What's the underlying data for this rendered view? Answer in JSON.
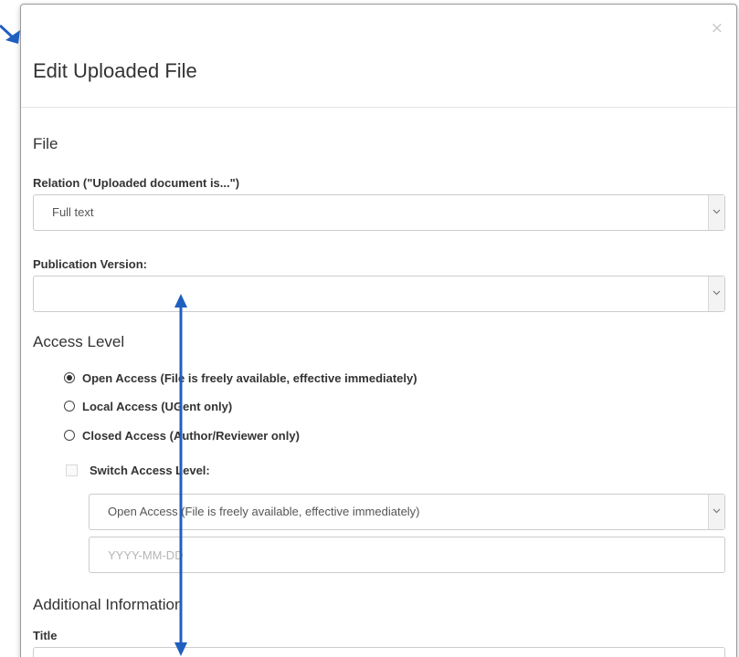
{
  "dialog": {
    "title": "Edit Uploaded File",
    "close_symbol": "×"
  },
  "file_section": {
    "heading": "File",
    "relation": {
      "label": "Relation (\"Uploaded document is...\")",
      "selected": "Full text"
    },
    "publication_version": {
      "label": "Publication Version:",
      "selected": ""
    }
  },
  "access_section": {
    "heading": "Access Level",
    "options": [
      {
        "label": "Open Access (File is freely available, effective immediately)",
        "checked": true
      },
      {
        "label": "Local Access (UGent only)",
        "checked": false
      },
      {
        "label": "Closed Access (Author/Reviewer only)",
        "checked": false
      }
    ],
    "switch": {
      "label": "Switch Access Level:",
      "checked": false,
      "selected": "Open Access (File is freely available, effective immediately)",
      "date_placeholder": "YYYY-MM-DD"
    }
  },
  "additional_section": {
    "heading": "Additional Information",
    "title_label": "Title"
  },
  "colors": {
    "annotation_arrow": "#1f5fbf",
    "border": "#cccccc",
    "text": "#333333"
  },
  "icons": [
    "close-icon",
    "chevron-down-icon",
    "annotation-arrow"
  ]
}
